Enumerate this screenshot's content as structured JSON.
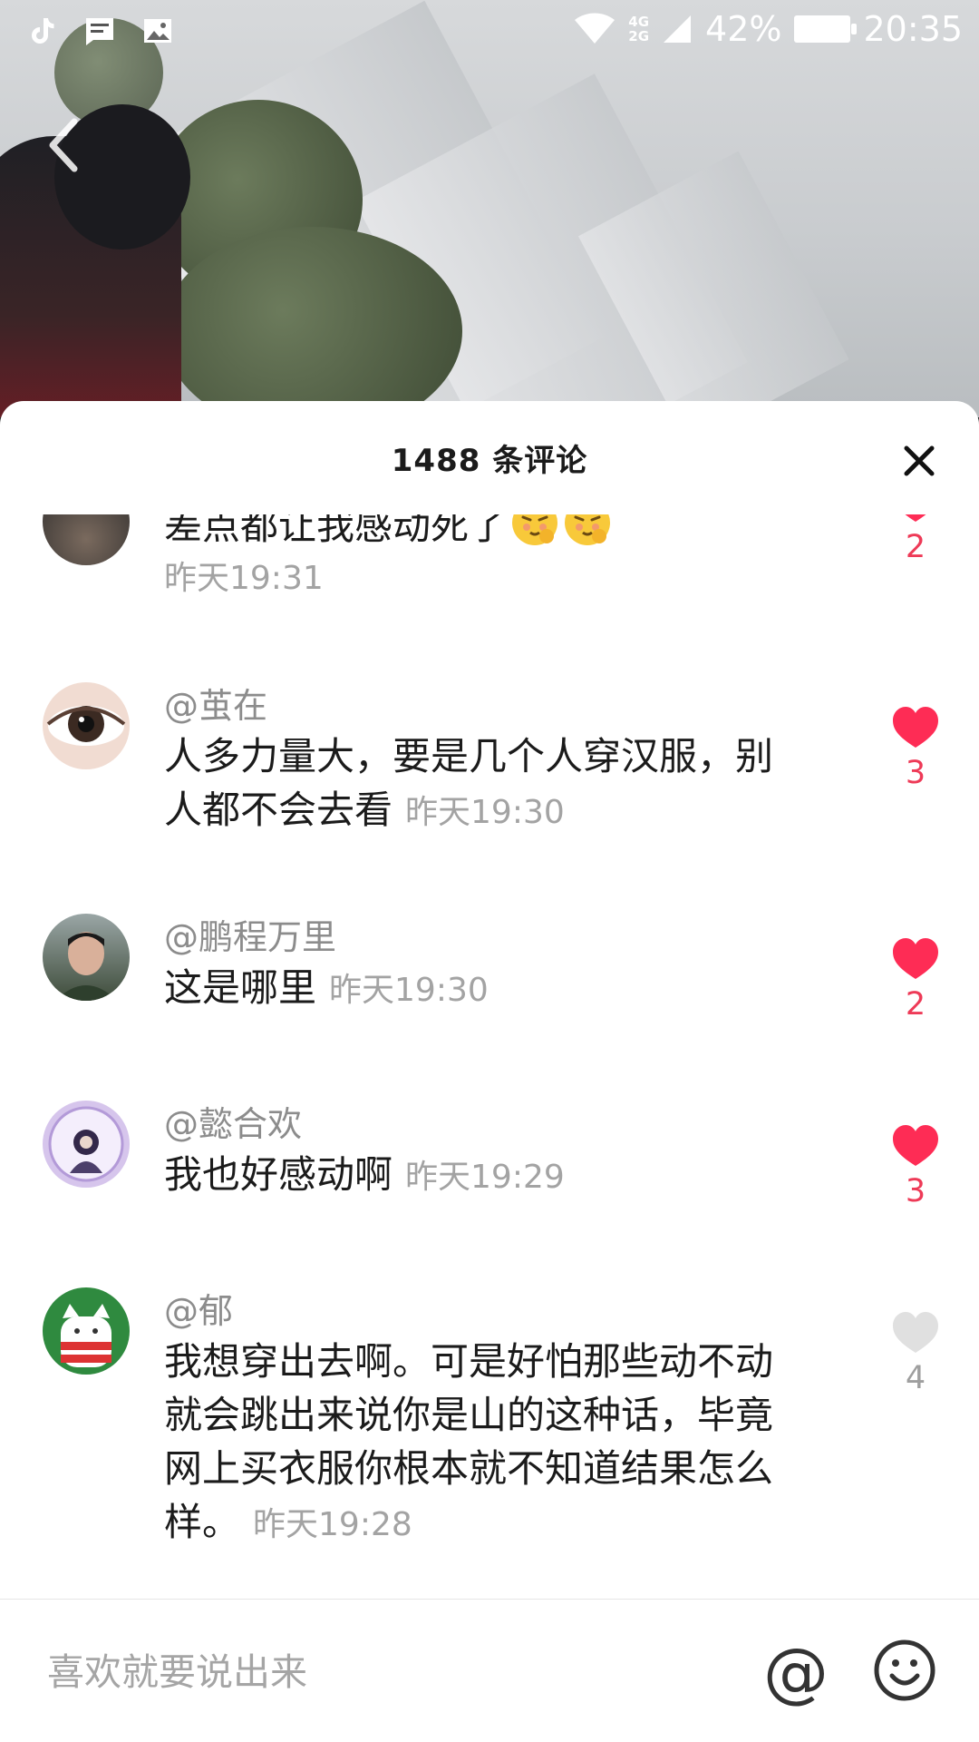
{
  "status_bar": {
    "network": [
      "4G",
      "2G"
    ],
    "battery": "42%",
    "time": "20:35"
  },
  "sheet": {
    "title": "1488 条评论"
  },
  "comments": [
    {
      "user": "",
      "text": "差点都让我感动死了",
      "time": "昨天19:31",
      "likes": "2",
      "liked": true,
      "emoji_count": 2
    },
    {
      "user": "@茧在",
      "text": "人多力量大，要是几个人穿汉服，别人都不会去看",
      "time": "昨天19:30",
      "likes": "3",
      "liked": true
    },
    {
      "user": "@鹏程万里",
      "text": "这是哪里",
      "time": "昨天19:30",
      "likes": "2",
      "liked": true
    },
    {
      "user": "@懿合欢",
      "text": "我也好感动啊",
      "time": "昨天19:29",
      "likes": "3",
      "liked": true
    },
    {
      "user": "@郁",
      "text": "我想穿出去啊。可是好怕那些动不动就会跳出来说你是山的这种话，毕竟网上买衣服你根本就不知道结果怎么样。",
      "time": "昨天19:28",
      "likes": "4",
      "liked": false
    }
  ],
  "input_bar": {
    "placeholder": "喜欢就要说出来",
    "at_symbol": "@"
  },
  "colors": {
    "like_active": "#fe2c55",
    "like_inactive": "#e0e0e0",
    "count_active": "#ee3a57"
  }
}
